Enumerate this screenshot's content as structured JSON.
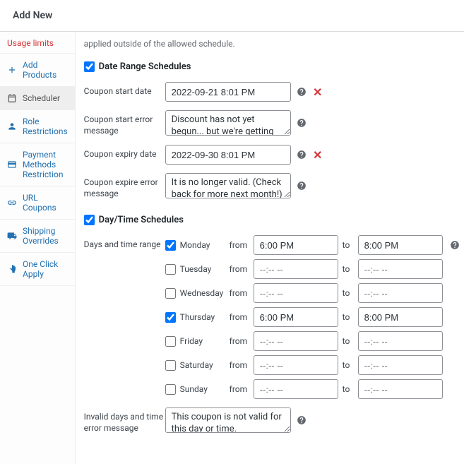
{
  "header": {
    "title": "Add New"
  },
  "sidebar": {
    "items": [
      {
        "label": "Usage limits",
        "icon": "limits",
        "truncated": true
      },
      {
        "label": "Add Products",
        "icon": "plus"
      },
      {
        "label": "Scheduler",
        "icon": "calendar",
        "active": true
      },
      {
        "label": "Role Restrictions",
        "icon": "person"
      },
      {
        "label": "Payment Methods Restriction",
        "icon": "card"
      },
      {
        "label": "URL Coupons",
        "icon": "link"
      },
      {
        "label": "Shipping Overrides",
        "icon": "truck"
      },
      {
        "label": "One Click Apply",
        "icon": "hand"
      }
    ]
  },
  "main": {
    "intro": "applied outside of the allowed schedule.",
    "date_section": {
      "checked": true,
      "title": "Date Range Schedules",
      "start_label": "Coupon start date",
      "start_value": "2022-09-21 8:01 PM",
      "start_err_label": "Coupon start error message",
      "start_err_value": "Discount has not yet begun... but we're getting there!",
      "expiry_label": "Coupon expiry date",
      "expiry_value": "2022-09-30 8:01 PM",
      "expire_err_label": "Coupon expire error message",
      "expire_err_value": "It is no longer valid. (Check back for more next month!)"
    },
    "daytime_section": {
      "checked": true,
      "title": "Day/Time Schedules",
      "days_label": "Days and time range",
      "from_label": "from",
      "to_label": "to",
      "time_placeholder": "--:-- --",
      "days": [
        {
          "name": "Monday",
          "checked": true,
          "from": "6:00 PM",
          "to": "8:00 PM"
        },
        {
          "name": "Tuesday",
          "checked": false,
          "from": "",
          "to": ""
        },
        {
          "name": "Wednesday",
          "checked": false,
          "from": "",
          "to": ""
        },
        {
          "name": "Thursday",
          "checked": true,
          "from": "6:00 PM",
          "to": "8:00 PM"
        },
        {
          "name": "Friday",
          "checked": false,
          "from": "",
          "to": ""
        },
        {
          "name": "Saturday",
          "checked": false,
          "from": "",
          "to": ""
        },
        {
          "name": "Sunday",
          "checked": false,
          "from": "",
          "to": ""
        }
      ],
      "invalid_label": "Invalid days and time error message",
      "invalid_value": "This coupon is not valid for this day or time."
    }
  }
}
